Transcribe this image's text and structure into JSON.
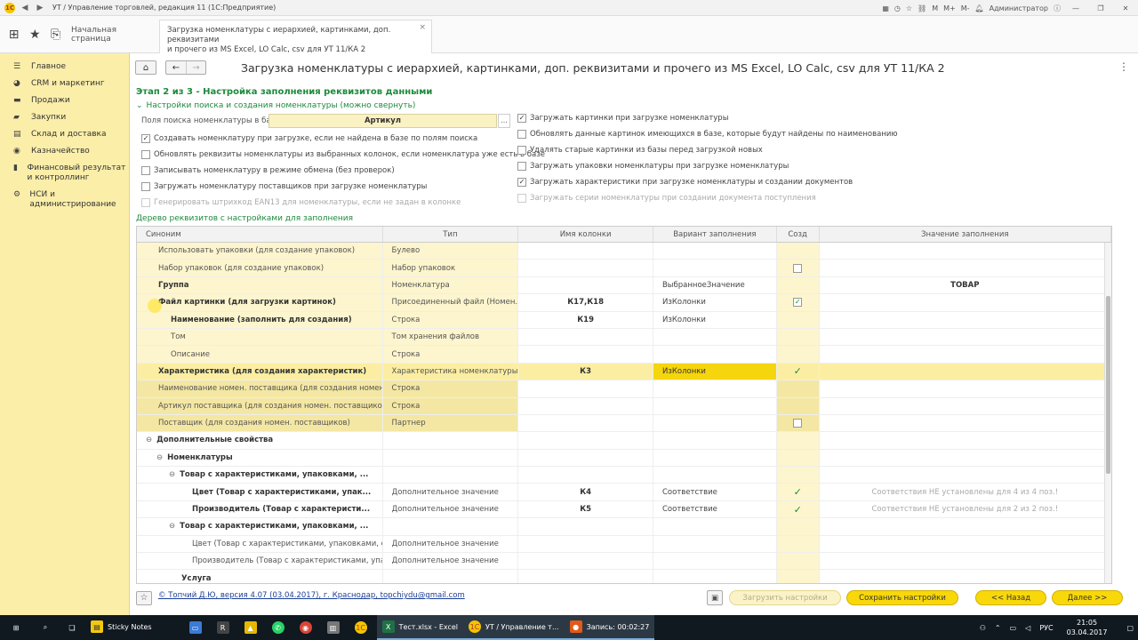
{
  "window": {
    "title": "УТ / Управление торговлей, редакция 11  (1С:Предприятие)",
    "user": "Администратор",
    "toolbar_items": [
      "M",
      "M+",
      "M-"
    ]
  },
  "tabs": {
    "home": "Начальная страница",
    "active_line1": "Загрузка номенклатуры с иерархией, картинками, доп. реквизитами",
    "active_line2": "и прочего из MS Excel, LO Calc, csv для УТ 11/КА 2"
  },
  "sidebar": {
    "items": [
      {
        "label": "Главное",
        "icon": "menu-icon"
      },
      {
        "label": "CRM и маркетинг",
        "icon": "crm-icon"
      },
      {
        "label": "Продажи",
        "icon": "sales-icon"
      },
      {
        "label": "Закупки",
        "icon": "purchases-icon"
      },
      {
        "label": "Склад и доставка",
        "icon": "warehouse-icon"
      },
      {
        "label": "Казначейство",
        "icon": "treasury-icon"
      },
      {
        "label": "Финансовый результат и контроллинг",
        "icon": "finance-icon"
      },
      {
        "label": "НСИ и администрирование",
        "icon": "gear-icon"
      }
    ]
  },
  "main": {
    "title": "Загрузка номенклатуры с иерархией, картинками, доп. реквизитами и прочего из MS Excel, LO Calc, csv для УТ 11/КА 2",
    "step_title": "Этап 2 из 3 - Настройка заполнения реквизитов данными",
    "section_link": "Настройки поиска и создания номенклатуры (можно свернуть)",
    "search_field_label": "Поля поиска номенклатуры в базе:",
    "search_field_value": "Артикул",
    "dots": "...",
    "left_checks": [
      {
        "label": "Создавать номенклатуру при загрузке, если не найдена в базе по полям поиска",
        "checked": true
      },
      {
        "label": "Обновлять реквизиты номенклатуры из выбранных колонок, если номенклатура уже есть в базе",
        "checked": false
      },
      {
        "label": "Записывать номенклатуру в режиме обмена (без проверок)",
        "checked": false
      },
      {
        "label": "Загружать номенклатуру поставщиков при загрузке номенклатуры",
        "checked": false
      },
      {
        "label": "Генерировать штрихкод EAN13 для номенклатуры, если не задан в колонке",
        "checked": false
      }
    ],
    "right_checks": [
      {
        "label": "Загружать картинки при загрузке номенклатуры",
        "checked": true
      },
      {
        "label": "Обновлять данные картинок имеющихся в базе, которые будут найдены по наименованию",
        "checked": false
      },
      {
        "label": "Удалять старые картинки из базы перед загрузкой новых",
        "checked": false
      },
      {
        "label": "Загружать упаковки номенклатуры при загрузке номенклатуры",
        "checked": false
      },
      {
        "label": "Загружать характеристики при загрузке номенклатуры и создании документов",
        "checked": true
      },
      {
        "label": "Загружать серии номенклатуры при создании документа поступления",
        "checked": false
      }
    ],
    "tree_label": "Дерево реквизитов с настройками для заполнения",
    "columns": [
      "Синоним",
      "Тип",
      "Имя колонки",
      "Вариант заполнения",
      "Созд",
      "Значение заполнения"
    ],
    "rows": [
      {
        "name": "Использовать упаковки (для создание упаковок)",
        "type": "Булево",
        "col": "",
        "variant": "",
        "create": "",
        "value": ""
      },
      {
        "name": "Набор упаковок (для создание упаковок)",
        "type": "Набор упаковок",
        "col": "",
        "variant": "",
        "create": "box",
        "value": ""
      },
      {
        "name": "Группа",
        "type": "Номенклатура",
        "col": "",
        "variant": "ВыбранноеЗначение",
        "create": "",
        "value": "ТОВАР"
      },
      {
        "name": "Файл картинки (для загрузки картинок)",
        "type": "Присоединенный файл (Номен...",
        "col": "К17,К18",
        "variant": "ИзКолонки",
        "create": "checkedbox",
        "value": ""
      },
      {
        "name": "Наименование (заполнить для создания)",
        "type": "Строка",
        "col": "К19",
        "variant": "ИзКолонки",
        "create": "",
        "value": ""
      },
      {
        "name": "Том",
        "type": "Том хранения файлов",
        "col": "",
        "variant": "",
        "create": "",
        "value": ""
      },
      {
        "name": "Описание",
        "type": "Строка",
        "col": "",
        "variant": "",
        "create": "",
        "value": ""
      },
      {
        "name": "Характеристика (для создания характеристик)",
        "type": "Характеристика номенклатуры",
        "col": "К3",
        "variant": "ИзКолонки",
        "create": "check",
        "value": ""
      },
      {
        "name": "Наименование номен. поставщика (для создания номен. ...",
        "type": "Строка",
        "col": "",
        "variant": "",
        "create": "",
        "value": ""
      },
      {
        "name": "Артикул поставщика (для создания номен. поставщиков)",
        "type": "Строка",
        "col": "",
        "variant": "",
        "create": "",
        "value": ""
      },
      {
        "name": "Поставщик (для создания номен. поставщиков)",
        "type": "Партнер",
        "col": "",
        "variant": "",
        "create": "box",
        "value": ""
      },
      {
        "name": "Дополнительные свойства",
        "type": "",
        "col": "",
        "variant": "",
        "create": "",
        "value": ""
      },
      {
        "name": "Номенклатуры",
        "type": "",
        "col": "",
        "variant": "",
        "create": "",
        "value": ""
      },
      {
        "name": "Товар с характеристиками, упаковками, ...",
        "type": "",
        "col": "",
        "variant": "",
        "create": "",
        "value": ""
      },
      {
        "name": "Цвет (Товар с характеристиками, упак...",
        "type": "Дополнительное значение",
        "col": "К4",
        "variant": "Соответствие",
        "create": "check",
        "value": "Соответствия НЕ установлены для 4 из 4 поз.!"
      },
      {
        "name": "Производитель (Товар с характеристи...",
        "type": "Дополнительное значение",
        "col": "К5",
        "variant": "Соответствие",
        "create": "check",
        "value": "Соответствия НЕ установлены для 2 из 2 поз.!"
      },
      {
        "name": "Товар с характеристиками, упаковками, ...",
        "type": "",
        "col": "",
        "variant": "",
        "create": "",
        "value": ""
      },
      {
        "name": "Цвет (Товар с характеристиками, упаковками, с...",
        "type": "Дополнительное значение",
        "col": "",
        "variant": "",
        "create": "",
        "value": ""
      },
      {
        "name": "Производитель (Товар с характеристиками, упак...",
        "type": "Дополнительное значение",
        "col": "",
        "variant": "",
        "create": "",
        "value": ""
      },
      {
        "name": "Услуга",
        "type": "",
        "col": "",
        "variant": "",
        "create": "",
        "value": ""
      }
    ],
    "tree_markers": {
      "minus": "⊖"
    },
    "footer": {
      "credit": "© Топчий Д.Ю, версия 4.07 (03.04.2017),  г. Краснодар, topchiydu@gmail.com",
      "load_settings": "Загрузить настройки",
      "save_settings": "Сохранить настройки",
      "back": "<< Назад",
      "next": "Далее >>"
    }
  },
  "taskbar": {
    "sticky": "Sticky Notes",
    "excel": "Тест.xlsx - Excel",
    "onec": "УТ / Управление т...",
    "rec": "Запись:  00:02:27",
    "lang": "РУС",
    "time": "21:05",
    "date": "03.04.2017"
  },
  "colors": {
    "accent_green": "#1d8a3c",
    "sidebar_yellow": "#fbeea9",
    "highlight_yellow": "#f5d50e",
    "button_yellow": "#f8d80a"
  }
}
